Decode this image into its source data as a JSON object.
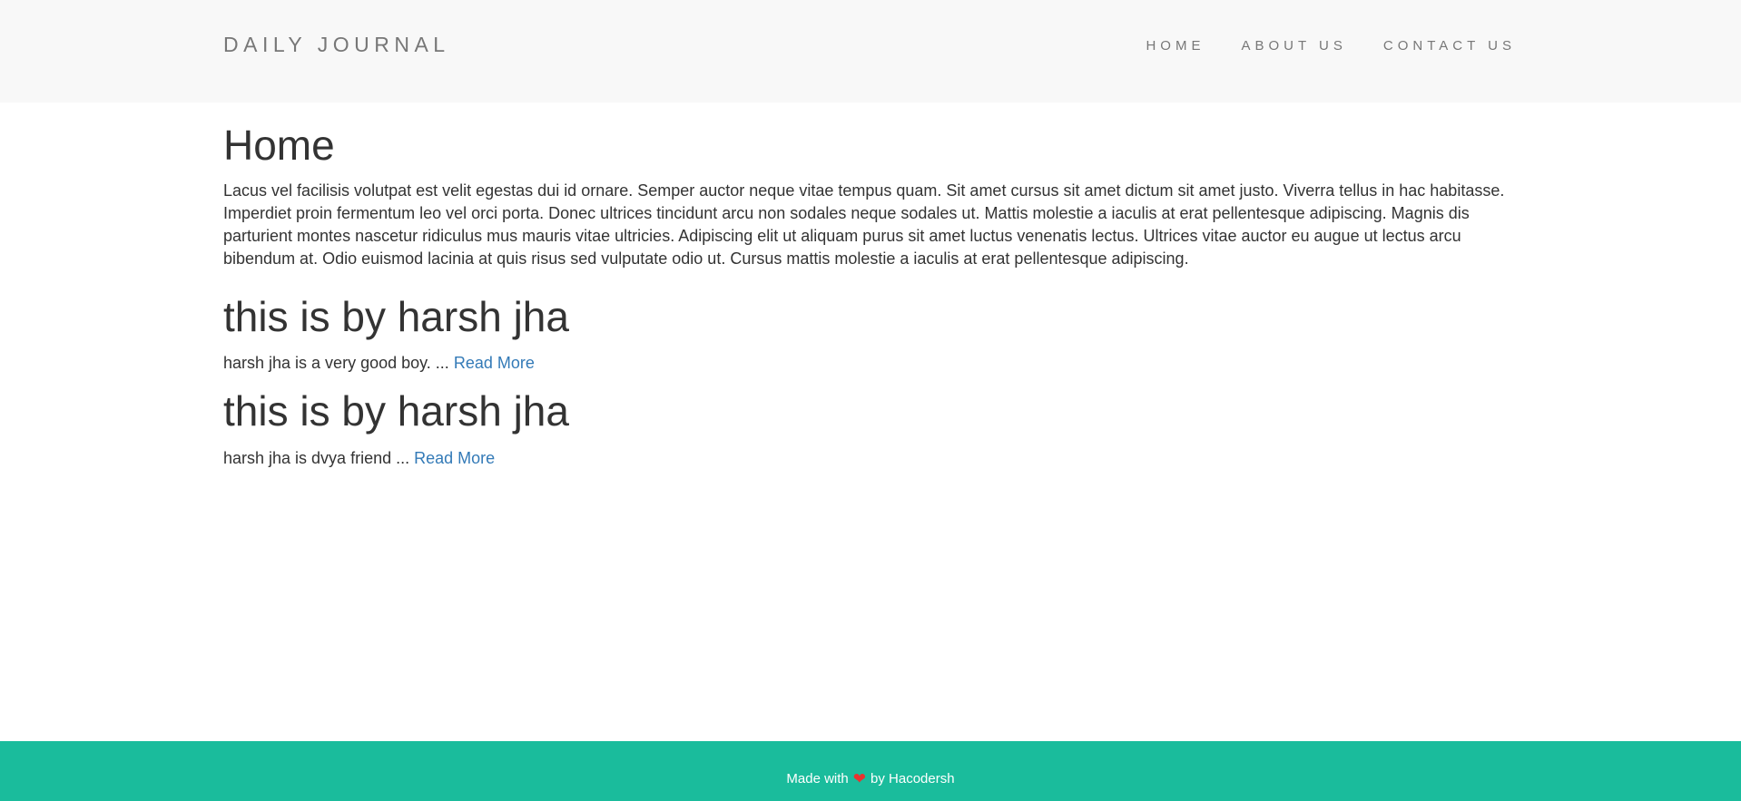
{
  "navbar": {
    "brand": "DAILY JOURNAL",
    "links": [
      {
        "label": "HOME"
      },
      {
        "label": "ABOUT US"
      },
      {
        "label": "CONTACT US"
      }
    ]
  },
  "main": {
    "page_title": "Home",
    "intro": "Lacus vel facilisis volutpat est velit egestas dui id ornare. Semper auctor neque vitae tempus quam. Sit amet cursus sit amet dictum sit amet justo. Viverra tellus in hac habitasse. Imperdiet proin fermentum leo vel orci porta. Donec ultrices tincidunt arcu non sodales neque sodales ut. Mattis molestie a iaculis at erat pellentesque adipiscing. Magnis dis parturient montes nascetur ridiculus mus mauris vitae ultricies. Adipiscing elit ut aliquam purus sit amet luctus venenatis lectus. Ultrices vitae auctor eu augue ut lectus arcu bibendum at. Odio euismod lacinia at quis risus sed vulputate odio ut. Cursus mattis molestie a iaculis at erat pellentesque adipiscing.",
    "posts": [
      {
        "title": "this is by harsh jha",
        "excerpt": "harsh jha is a very good boy. ...",
        "read_more": "Read More"
      },
      {
        "title": "this is by harsh jha",
        "excerpt": "harsh jha is dvya friend ...",
        "read_more": "Read More"
      }
    ]
  },
  "footer": {
    "prefix": "Made with",
    "icon": "heart-icon",
    "suffix": "by Hacodersh"
  },
  "colors": {
    "navbar_bg": "#f8f8f8",
    "footer_bg": "#1abc9c",
    "link": "#337ab7",
    "heart": "#e8322f"
  }
}
